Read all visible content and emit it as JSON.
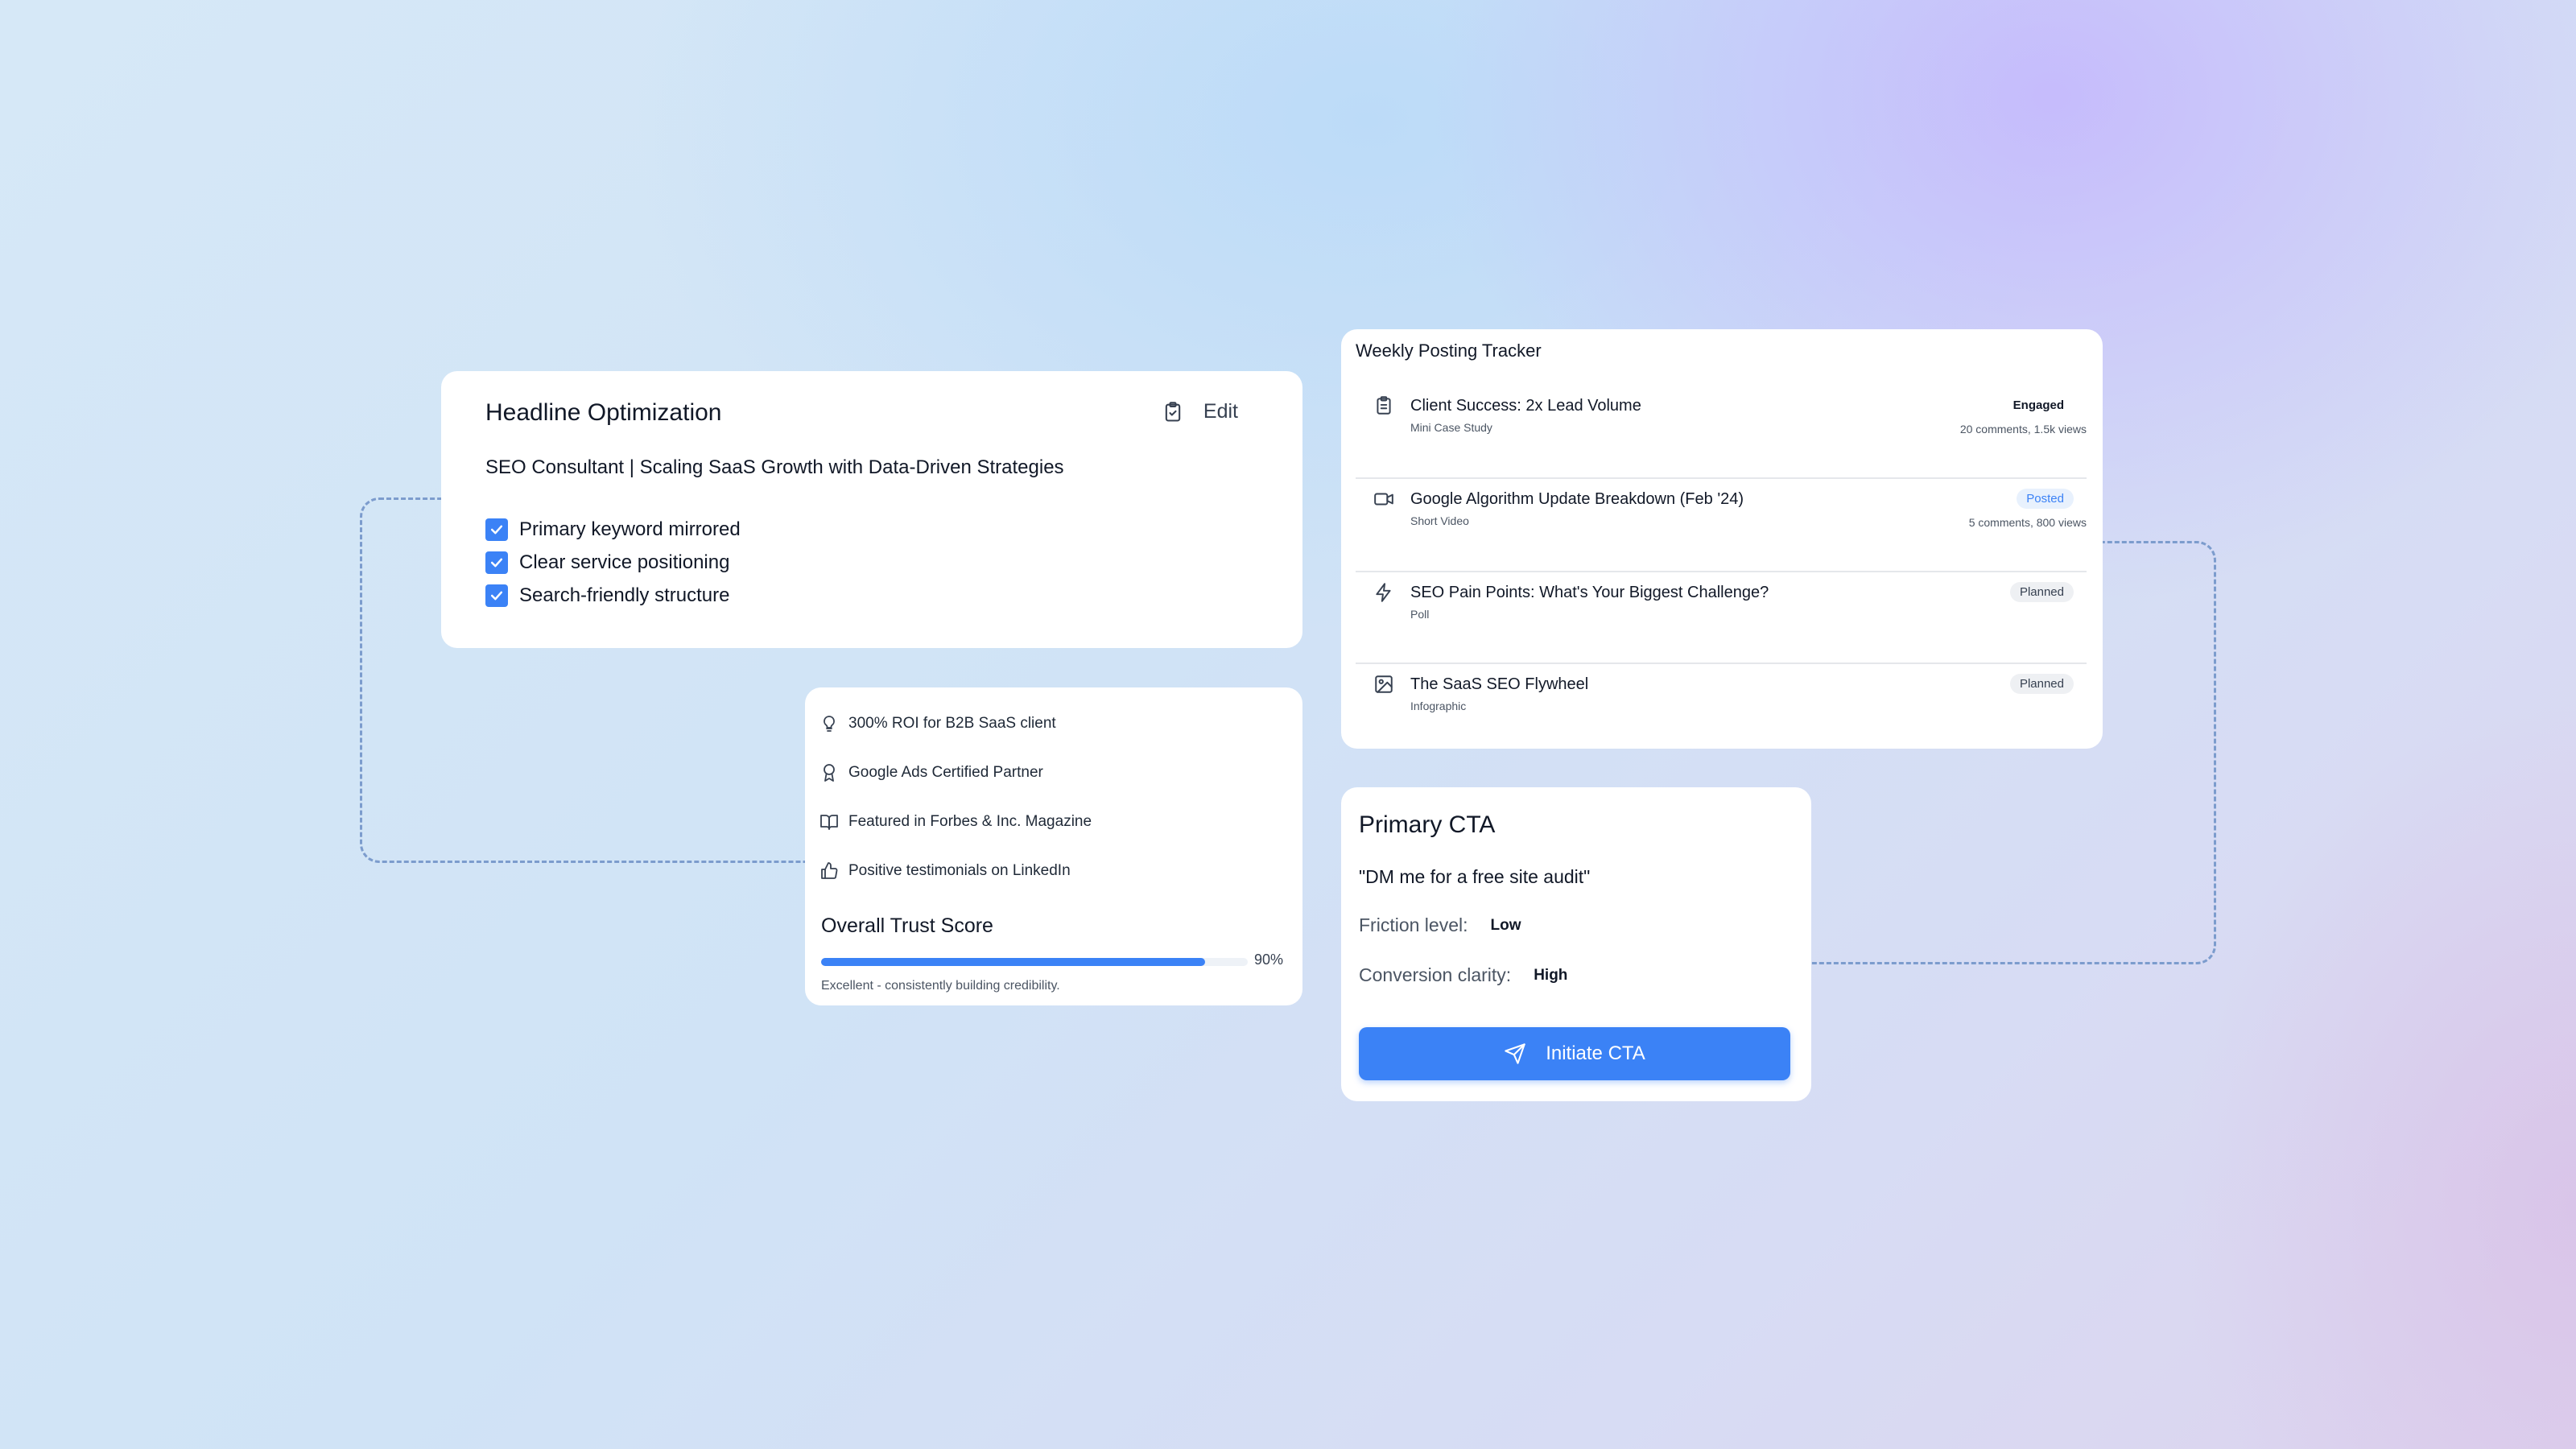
{
  "headline": {
    "title": "Headline Optimization",
    "edit_label": "Edit",
    "text": "SEO Consultant | Scaling SaaS Growth with Data-Driven Strategies",
    "checks": [
      "Primary keyword mirrored",
      "Clear service positioning",
      "Search-friendly structure"
    ]
  },
  "trust": {
    "items": [
      {
        "icon": "lightbulb-icon",
        "label": "300% ROI for B2B SaaS client"
      },
      {
        "icon": "award-icon",
        "label": "Google Ads Certified Partner"
      },
      {
        "icon": "book-icon",
        "label": "Featured in Forbes & Inc. Magazine"
      },
      {
        "icon": "thumbs-up-icon",
        "label": "Positive testimonials on LinkedIn"
      }
    ],
    "score_title": "Overall Trust Score",
    "score_value": 0.9,
    "score_label": "90%",
    "note": "Excellent - consistently building credibility.",
    "accent": "#3b82f6"
  },
  "tracker": {
    "title": "Weekly Posting Tracker",
    "posts": [
      {
        "icon": "clipboard-icon",
        "name": "Client Success: 2x Lead Volume",
        "type": "Mini Case Study",
        "status": "Engaged",
        "stats": "20 comments, 1.5k views"
      },
      {
        "icon": "video-icon",
        "name": "Google Algorithm Update Breakdown (Feb '24)",
        "type": "Short Video",
        "status": "Posted",
        "stats": "5 comments, 800 views"
      },
      {
        "icon": "zap-icon",
        "name": "SEO Pain Points: What's Your Biggest Challenge?",
        "type": "Poll",
        "status": "Planned",
        "stats": ""
      },
      {
        "icon": "image-icon",
        "name": "The SaaS SEO Flywheel",
        "type": "Infographic",
        "status": "Planned",
        "stats": ""
      }
    ]
  },
  "cta": {
    "title": "Primary CTA",
    "quote": "\"DM me for a free site audit\"",
    "friction_label": "Friction level:",
    "friction_value": "Low",
    "clarity_label": "Conversion clarity:",
    "clarity_value": "High",
    "button_label": "Initiate CTA"
  }
}
